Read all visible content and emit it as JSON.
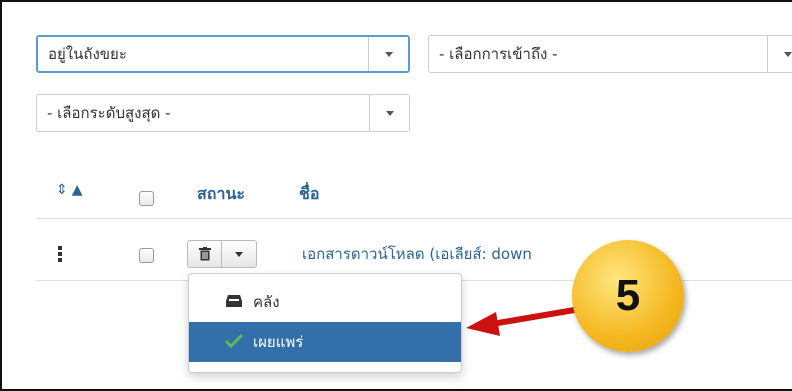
{
  "filters": {
    "status_value": "อยู่ในถังขยะ",
    "access_placeholder": "- เลือกการเข้าถึง -",
    "level_placeholder": "- เลือกระดับสูงสุด -"
  },
  "table": {
    "headers": {
      "status": "สถานะ",
      "title": "ชื่อ"
    },
    "rows": [
      {
        "title": "เอกสารดาวน์โหลด (เอเลียส์: down"
      }
    ]
  },
  "status_menu": {
    "items": [
      {
        "label": "คลัง",
        "icon": "archive-icon",
        "active": false
      },
      {
        "label": "เผยแพร่",
        "icon": "check-icon",
        "active": true
      }
    ]
  },
  "annotation": {
    "step": "5"
  },
  "colors": {
    "link": "#2a6496",
    "menu_active": "#336fa8",
    "callout": "#f4b820",
    "arrow": "#cc1111",
    "check": "#5cb85c"
  }
}
